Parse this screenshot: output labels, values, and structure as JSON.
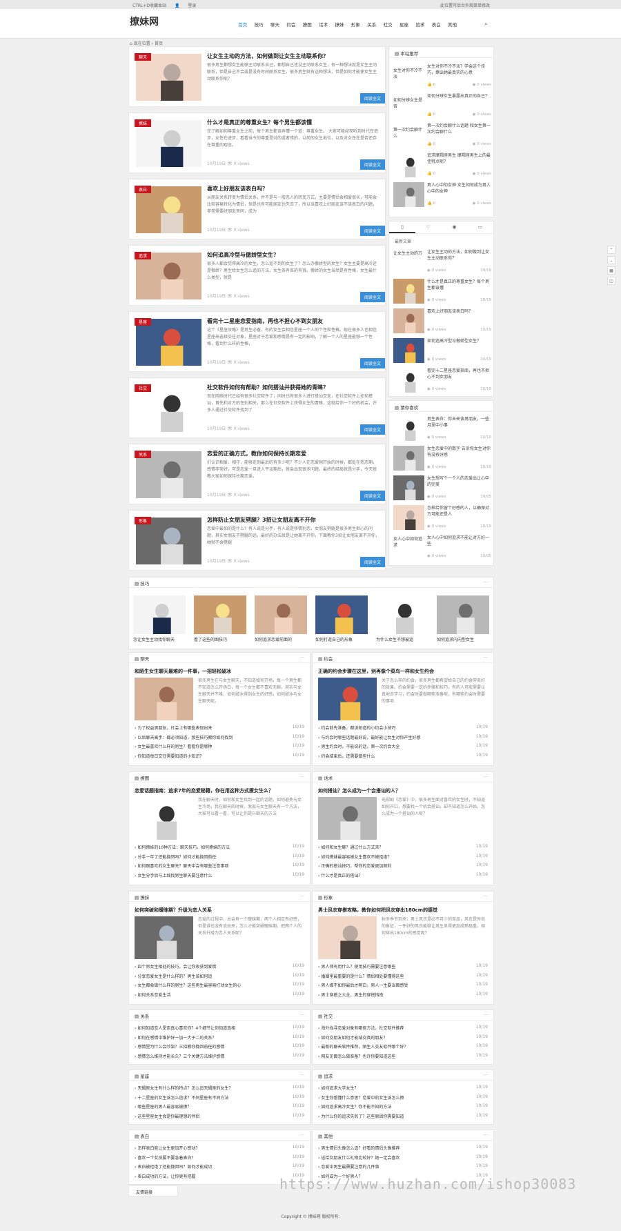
{
  "topbar": {
    "bookmark": "CTRL+D收藏本站",
    "login": "登录",
    "notice": "此位置可后台外观菜单修改"
  },
  "site": {
    "logo": "撩妹网"
  },
  "nav": [
    "首页",
    "技巧",
    "聊天",
    "约会",
    "撩图",
    "话术",
    "撩妹",
    "形象",
    "关系",
    "社交",
    "星座",
    "追求",
    "表白",
    "其他"
  ],
  "breadcrumb": "现在位置 › 首页",
  "articles": [
    {
      "tag": "聊天",
      "title": "让女生主动的方法，如何做到让女生主动联系你？",
      "desc": "很多男生都想女生能够主动联系自己，都想自己还没主动联系女生，有一种想法就是女生主动联系，但是自己不会或是没有时间联系女生，很多男生就有这种想法，但是如何才能使女生主动联系你呢？",
      "meta": "",
      "btn": "阅读全文"
    },
    {
      "tag": "撩妹",
      "title": "什么才是真正的尊重女生？每个男生都该懂",
      "desc": "在了解如何尊重女生之前，每个男生都该弄懂一个道：尊重女生。 大家可能经常听到时代在进步，女性在进步，看看当今的尊重是对的或者错的，以前的女生地位，以及对女性在是否还存在尊重的观念。",
      "meta": "10月19日 👁 0 views",
      "btn": "阅读全文"
    },
    {
      "tag": "表白",
      "title": "喜欢上好朋友该表白吗？",
      "desc": "从朋友关系转变为情侣关系，并不是与一般恋人的转变方式，主要是情侣会相爱很长，可能会比较容易转化为情侣，但是也有可能朋友也失去了，所以当喜欢上好朋友该不该表白的问题，非常需要好朋友来同，成为",
      "meta": "10月19日 👁 0 views",
      "btn": "阅读全文"
    },
    {
      "tag": "追求",
      "title": "如何追高冷型与傲娇型女生？",
      "desc": "很多人都会觉得高冷的女生，怎么追不到的女生了？怎么办傲娇型的女生？女生主要是高冷还是傲娇？男生给女生怎么追的方法，女生各有各的有钱。傲娇的女生当然是有性格，女生最什么类型，就是",
      "meta": "10月19日 👁 0 views",
      "btn": "阅读全文"
    },
    {
      "tag": "星座",
      "title": "看完十二星座恋爱指南，再也不担心不到女朋友",
      "desc": "这个《星座攻略》是男生必备，有的女生会相信星座一个人的个性和性格。现在很多人也相信星座来选择交往对象，星座对于恋爱和感情是有一定的影响，了解一个人的星座能够一个性格，看到什么样的性格，",
      "meta": "10月19日 👁 0 views",
      "btn": "阅读全文"
    },
    {
      "tag": "社交",
      "title": "社交软件如何有帮助？如何搭讪并获得她的青睐？",
      "desc": "现在网络时代已经有很多社交软件了，同时也有很多人进行搭讪交友，在社交软件上如何搭讪，首先和对方的性别相关，那么在社交软件上获得女生的青睐，这就给你一个好的机会，许多人通过社交软件找到了",
      "meta": "10月19日 👁 0 views",
      "btn": "阅读全文"
    },
    {
      "tag": "关系",
      "title": "恋爱的正确方式，教你如何保持长期恋爱",
      "desc": "们认识相爱、相守，能够走到最后的有多少呢？不少人在恋爱刚开始的时候，都处在热恋期，感情非常好，可是恋爱一旦进入平淡期后，就会出现很多问题，最终的结局就是分手，今天就教大家如何保持长期恋爱。",
      "meta": "10月19日 👁 0 views",
      "btn": "阅读全文"
    },
    {
      "tag": "形象",
      "title": "怎样防止女朋友劈腿？3招让女朋友离不开你",
      "desc": "恋爱中最怕的是什么？有人说是分手，有人说是移情别恋，女朋友劈腿是很多男生担心的问题，其实女朋友不劈腿的话，最好的办法就是让她离不开你，下面教你3招让女朋友离不开你，她就不会劈腿",
      "meta": "10月19日 👁 0 views",
      "btn": "阅读全文"
    }
  ],
  "recommend": {
    "title": "本站推荐",
    "items": [
      {
        "title": "女生对你不冷不淡？学会这个技巧，撩出她最真实的心意",
        "views": "0",
        "vtext": "0 views",
        "left": "女生对你不冷不淡"
      },
      {
        "title": "如何分辨女生暴露出真正的自己？",
        "views": "0",
        "vtext": "0 views",
        "left": "如何分辨女生是否"
      },
      {
        "title": "第一次约会聊什么话题 和女生第一次约会聊什么",
        "views": "0",
        "vtext": "0 views",
        "left": "第一次约会聊什么"
      },
      {
        "title": "追求摩羯座男生 摩羯座男生上的最佳特点呢？",
        "views": "0",
        "vtext": "0 views",
        "left": ""
      },
      {
        "title": "男人心中的女神 女生如何成为男人心中的女神",
        "views": "0",
        "vtext": "0 views",
        "left": ""
      }
    ]
  },
  "sidetabs": {
    "label": "最新文章",
    "items": [
      {
        "title": "让女生主动的方法，如何做到让女生主动联系你？",
        "date": "10/19",
        "views": "0 views",
        "left": "让女生主动的方"
      },
      {
        "title": "什么才是真正的尊重女生？每个男生都该懂",
        "date": "10/19",
        "views": "0 views"
      },
      {
        "title": "喜欢上好朋友该表白吗？",
        "date": "10/19",
        "views": "0 views"
      },
      {
        "title": "如何追高冷型与傲娇型女生？",
        "date": "10/19",
        "views": "0 views"
      },
      {
        "title": "看完十二星座恋爱指南，再也不担心不到女朋友",
        "date": "10/19",
        "views": "0 views"
      }
    ]
  },
  "tags": {
    "title": "猜你喜欢",
    "items": [
      {
        "title": "男生表白：你未来该男朋友，一些月里中小事",
        "date": "10/19",
        "views": "0 views"
      },
      {
        "title": "女生恋爱中的数字 告诉你女生对你有没有好感",
        "date": "10/19",
        "views": "0 views"
      },
      {
        "title": "女生想写个一个人的恋爱出让心中的完美",
        "date": "10/05",
        "views": "0 views"
      },
      {
        "title": "怎样给你留个好感的人，以确保对方可能还是人",
        "date": "10/19",
        "views": "0 views"
      },
      {
        "title": "女人心中如何追求不能让对方好一些",
        "date": "10/05",
        "views": "0 views",
        "left": "女人心中如何追求"
      }
    ]
  },
  "gallery": {
    "title": "技巧",
    "items": [
      "怎让女生主动找你聊天",
      "看了这些的图技巧",
      "如何追求恋爱前面的",
      "如何打造自己的形象",
      "为什么女生不想被追",
      "如何追求内向型女生"
    ]
  },
  "sections": [
    {
      "name": "聊天",
      "title": "和陌生女生聊天最难的一件事，一招轻松破冰",
      "desc": "很多男生在与女生聊天，不知道如何开场，每一个男生都不知道怎么开场白，每一个女生都不喜欢无聊，其实与女生聊天并不难，如何破冰得到女生的好感，如何破冰与女生聊天呢。",
      "list": [
        [
          "为了权益男朋友，社会上有哪些表现出来",
          "10/19"
        ],
        [
          "以后聊天高手：都必须知道，那些技巧教你如何找到",
          "10/19"
        ],
        [
          "女生最喜欢什么样的男生？看看你是哪种",
          "10/19"
        ],
        [
          "你知道每日交往需要知道的小知识？",
          "10/19"
        ]
      ]
    },
    {
      "name": "约会",
      "title": "正确的约会步骤在这里，别再像个菜鸟一样和女生约会",
      "desc": "关于怎么样的约会，很多男生都希望给自己的约会带来好的效果。约会需要一定的步骤和技巧，有的人可能需要认真地去学习，约会时要做哪些准备呢，有哪些约会时需要的事项",
      "list": [
        [
          "约会前先准备，都该知道的小约会小技巧",
          "10/19"
        ],
        [
          "与约会时哪些话题最好说，最好能让女生对你产生好感",
          "10/19"
        ],
        [
          "男生约会时，不能说的话，第一次约会大全",
          "10/19"
        ],
        [
          "约会结束后，还需要做些什么",
          "10/19"
        ]
      ]
    },
    {
      "name": "撩图",
      "title": "恋爱话题指南：追求7年的恋爱秘籍，你在用这种方式撩女生么？",
      "desc": "我在聊天时，如何和女生找到一起的话题，如何避免与女生冷场，我在聊天的时候，发现与女生聊天有一个方法，大家可以看一看，可以让你提升聊天的方法",
      "list": [
        [
          "如何撩妹的10种方法：聊天技巧，如何撩妹的方法",
          "10/19"
        ],
        [
          "分手一年了还能挽回吗？如何才能挽回前任",
          "10/19"
        ],
        [
          "如何跟喜欢的女生聊天？聊天中会有哪些注意事项",
          "10/19"
        ],
        [
          "女生分手后与上线找男生聊天要注意什么",
          "10/19"
        ]
      ]
    },
    {
      "name": "话术",
      "title": "如何搭讪？怎么成为一个会搭讪的人？",
      "desc": "电视剧《恋爱》中，很多男生面对喜欢的女生时，不知道如何开口，想要找一个机会搭讪，却不知道怎么开始，怎么成为一个搭讪的人呢？",
      "list": [
        [
          "如何和女生聊？通过什么方式来？",
          "10/19"
        ],
        [
          "如何撩妹最容易被女生喜欢不被拒绝？",
          "10/19"
        ],
        [
          "正确的搭讪技巧，帮你的恋爱更加顺利",
          "10/19"
        ],
        [
          "什么才是真正的搭讪？",
          "10/19"
        ]
      ]
    },
    {
      "name": "撩妹",
      "title": "如何突破和暧昧期？升级为恋人关系",
      "desc": "恋爱的过程中，总会有一个暧昧期，两个人相互有好感，但是谁也没有说出来，怎么才能突破暧昧期，把两个人的关系升级为恋人关系呢？",
      "list": [
        [
          "四个男女生相处的技巧，会让你收获到爱情",
          "10/19"
        ],
        [
          "分享恋爱女生是什么样的？男生该如何追",
          "10/19"
        ],
        [
          "女生都会做什么样的男生？这些男生最容易打动女生的心",
          "10/19"
        ],
        [
          "如何关系恋爱生活",
          "10/19"
        ]
      ]
    },
    {
      "name": "形象",
      "title": "男士风衣穿搭攻略，教你如何把风衣穿出180cm的感觉",
      "desc": "秋冬季节到来，男士风衣是必不可少的单品，风衣是时尚的象征，一件好的风衣能够让男生显得更加成熟稳重，如何穿出180cm的感觉呢？",
      "list": [
        [
          "男人帅有用什么？使用技巧需要注意哪些",
          "10/19"
        ],
        [
          "婚姻里最重要的是什么？情侣相处要懂得这些",
          "10/19"
        ],
        [
          "男人缘不如你最后才明白，男人一生要当面感受",
          "10/19"
        ],
        [
          "男士穿搭之大全，男生的穿搭指南",
          "10/19"
        ]
      ]
    },
    {
      "name": "关系",
      "list": [
        [
          "如何知道恋人是否真心喜欢你？4个细节让你知道真相",
          "10/19"
        ],
        [
          "如何在感情中维护好一加一大于二的关系？",
          "10/19"
        ],
        [
          "感情里为什么会吵架？三招教你挽回前任的感情",
          "10/19"
        ],
        [
          "感情怎么维持才能长久？三个关键方法维护感情",
          "10/19"
        ]
      ]
    },
    {
      "name": "社交",
      "list": [
        [
          "海外找寻恋爱对象有哪些方法，社交软件推荐",
          "10/19"
        ],
        [
          "如何交朋友如何才能结交真的朋友？",
          "10/19"
        ],
        [
          "最新的聊天软件推荐，陌生人交友软件哪个好？",
          "10/19"
        ],
        [
          "网友见面怎么做准备？也许你要知道这些",
          "10/19"
        ]
      ]
    },
    {
      "name": "星座",
      "list": [
        [
          "天蝎座女生有什么样的特点？怎么追天蝎座的女生？",
          "10/19"
        ],
        [
          "十二星座的女生该怎么追求？不同星座有不同方法",
          "10/19"
        ],
        [
          "哪些星座的男人最容易被撩？",
          "10/19"
        ],
        [
          "这些星座女生会是你最理想的伴侣",
          "10/19"
        ]
      ]
    },
    {
      "name": "追求",
      "list": [
        [
          "如何追求大学女生？",
          "10/19"
        ],
        [
          "女生你看懂什么意思？恋爱中的女生该怎么撩",
          "10/19"
        ],
        [
          "如何追求高冷女生？你不能不知的方法",
          "10/19"
        ],
        [
          "为什么你的追求失败了？这些原因你需要知道",
          "10/19"
        ]
      ]
    },
    {
      "name": "表白",
      "list": [
        [
          "怎样表白能让女生更加开心感动？",
          "10/19"
        ],
        [
          "喜欢一个女孩要不要急着表白？",
          "10/19"
        ],
        [
          "表白被拒绝了还能挽回吗？如何才能成功",
          "10/19"
        ],
        [
          "表白成功的方法，让你更有把握",
          "10/19"
        ]
      ]
    },
    {
      "name": "其他",
      "list": [
        [
          "男生情侣头像怎么选？好看的情侣头像推荐",
          "10/19"
        ],
        [
          "送给女朋友什么礼物比较好？她一定会喜欢",
          "10/19"
        ],
        [
          "恋爱中男生最需要注意的几件事",
          "10/19"
        ],
        [
          "如何成为一个好男人？",
          "10/19"
        ]
      ]
    }
  ],
  "friend_links": "友情链接",
  "footer": "Copyright © 撩妹网 版权所有.",
  "watermark": "https://www.huzhan.com/ishop30083",
  "colors": {
    "accent": "#1e88d2",
    "tag": "#c9151e",
    "button": "#3a8fd6"
  }
}
